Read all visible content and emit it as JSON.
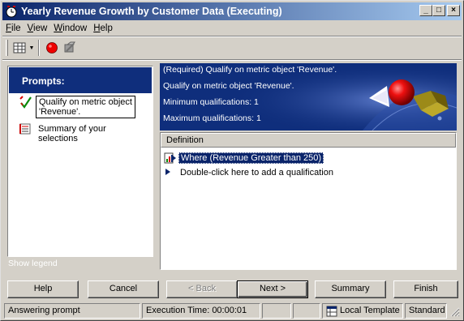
{
  "window": {
    "title": "Yearly Revenue Growth by Customer Data (Executing)",
    "controls": {
      "minimize": "_",
      "maximize": "□",
      "close": "×"
    }
  },
  "menu": {
    "items": [
      {
        "underline": "F",
        "rest": "ile"
      },
      {
        "underline": "V",
        "rest": "iew"
      },
      {
        "underline": "W",
        "rest": "indow"
      },
      {
        "underline": "H",
        "rest": "elp"
      }
    ]
  },
  "toolbar": {
    "icons": [
      "grid-view-icon",
      "dropdown-arrow-icon",
      "record-icon",
      "cancel-execution-icon"
    ]
  },
  "left_panel": {
    "header": "Prompts:",
    "items": [
      {
        "line1": "Qualify on metric object",
        "line2": "'Revenue'.",
        "icon": "checkmark-icon",
        "selected": true
      },
      {
        "line1": "Summary of your",
        "line2": "selections",
        "icon": "summary-list-icon",
        "selected": false
      }
    ],
    "show_legend": "Show legend"
  },
  "banner": {
    "lines": [
      "(Required) Qualify on metric object 'Revenue'.",
      "Qualify on metric object 'Revenue'.",
      "Minimum qualifications: 1",
      "Maximum qualifications: 1"
    ]
  },
  "definition": {
    "header": "Definition",
    "rows": [
      {
        "text": "Where (Revenue Greater than 250)",
        "icon": "metric-qualification-icon",
        "selected": true
      },
      {
        "text": "Double-click here to add a qualification",
        "icon": "arrow-right-icon",
        "selected": false
      }
    ]
  },
  "buttons": {
    "help": "Help",
    "cancel": "Cancel",
    "back": "< Back",
    "next": "Next >",
    "summary": "Summary",
    "finish": "Finish"
  },
  "status": {
    "message": "Answering prompt",
    "execution_time": "Execution Time: 00:00:01",
    "template": "Local Template",
    "mode": "Standard"
  },
  "colors": {
    "title_gradient_start": "#0a246a",
    "title_gradient_end": "#a6caf0",
    "panel_header": "#0f2e7c",
    "selection": "#0a246a"
  }
}
